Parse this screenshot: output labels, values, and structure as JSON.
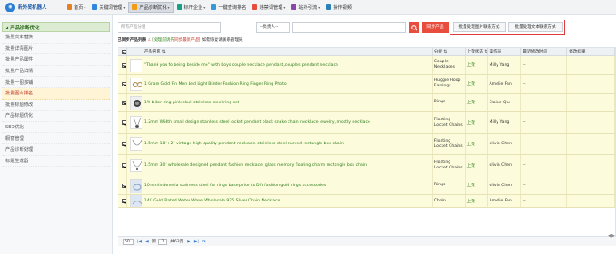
{
  "logo": {
    "text": "新外贸机器人"
  },
  "nav": [
    {
      "label": "首页",
      "icon": "home-icon",
      "color": "#e67e22",
      "caret": true
    },
    {
      "label": "关键词管理",
      "icon": "key-icon",
      "color": "#2e86de",
      "caret": true
    },
    {
      "label": "产品诊断优化",
      "icon": "product-icon",
      "color": "#f39c12",
      "caret": true,
      "active": true
    },
    {
      "label": "标杆企业",
      "icon": "building-icon",
      "color": "#16a085",
      "caret": true
    },
    {
      "label": "一键查询排名",
      "icon": "search-rank-icon",
      "color": "#3498db",
      "caret": false
    },
    {
      "label": "违禁词管理",
      "icon": "ban-icon",
      "color": "#e74c3c",
      "caret": true
    },
    {
      "label": "站外引流",
      "icon": "traffic-icon",
      "color": "#8e44ad",
      "caret": true
    },
    {
      "label": "操作视频",
      "icon": "video-icon",
      "color": "#2980b9",
      "caret": false
    }
  ],
  "sidebar": {
    "header": "产品诊断优化",
    "items": [
      "批量文本替换",
      "批量详情图片",
      "批量产品属性",
      "批量产品详情",
      "批量一图多铺",
      "批量图片排名",
      "批量标题修改",
      "产品标题优化",
      "SEO优化",
      "橱窗管理",
      "产品诊断处理",
      "标题生成器"
    ],
    "active_index": 5
  },
  "filters": {
    "product_placeholder": "所有产品分组",
    "owner_select": "--负责人--",
    "keyword_placeholder": "",
    "search_icon": "search-icon",
    "sync_label": "同步产品",
    "batch_image_label": "批量处理图片联系方式",
    "batch_text_label": "批量处理文本联系方式"
  },
  "info": {
    "prefix": "已同步产品列表",
    "warn_icon": "warning-icon",
    "link_text": "[处理前请先",
    "note": "同步最新产品]",
    "tail": "如需恢复请联系管理员"
  },
  "table": {
    "headers": [
      "",
      "",
      "产品名称 ⇅",
      "分组 ⇅",
      "上架状态 ⇅",
      "操作员",
      "最近修改时间",
      "修改结果"
    ],
    "rows": [
      {
        "checked": true,
        "title": "\"Thank you fo being beside me\" with boys couple necklace pendant,couples pendant necklace",
        "category": "Couple Necklaces",
        "status": "上架",
        "operator": "Milly Yang",
        "time": "--",
        "result": ""
      },
      {
        "checked": true,
        "title": "1 Gram Gold Fin Men Led Light Binder Fashion Ring Finger Ring Photo",
        "category": "Huggie Hoop Earrings",
        "status": "上架",
        "operator": "Amelie Fan",
        "time": "--",
        "result": ""
      },
      {
        "checked": true,
        "title": "1% biker ring pink skull stainless steel ring set",
        "category": "Rings",
        "status": "上架",
        "operator": "Elaine Qiu",
        "time": "--",
        "result": ""
      },
      {
        "checked": true,
        "title": "1.2mm Width small design stainless steel locket pendant black snake chain necklace jewelry, mostly necklace",
        "category": "Floating Locket Chains",
        "status": "上架",
        "operator": "Milly Yang",
        "time": "--",
        "result": ""
      },
      {
        "checked": true,
        "title": "1.5mm 18\"+2\" vintage high quality pendant necklace, stainless steel curved rectangle box chain",
        "category": "Floating Locket Chains",
        "status": "上架",
        "operator": "olivia Chen",
        "time": "--",
        "result": ""
      },
      {
        "checked": true,
        "title": "1.5mm 30\" wholesale designed pendant fashion necklace, glass memory floating charm rectangle box chain",
        "category": "Floating Locket Chains",
        "status": "上架",
        "operator": "olivia Chen",
        "time": "--",
        "result": ""
      },
      {
        "checked": true,
        "title": "10mm Indonesia stainless steel for rings base price to DIY fashion gold rings accessories",
        "category": "Rings",
        "status": "上架",
        "operator": "olivia Chen",
        "time": "--",
        "result": ""
      },
      {
        "checked": true,
        "title": "14K Gold Plated Water Wave Wholesale 925 Silver Chain Necklace",
        "category": "Chain",
        "status": "上架",
        "operator": "Amelie Fan",
        "time": "--",
        "result": ""
      }
    ]
  },
  "pager": {
    "page_size": "50",
    "page_label": "第",
    "page": "1",
    "total_label": "共63页"
  }
}
